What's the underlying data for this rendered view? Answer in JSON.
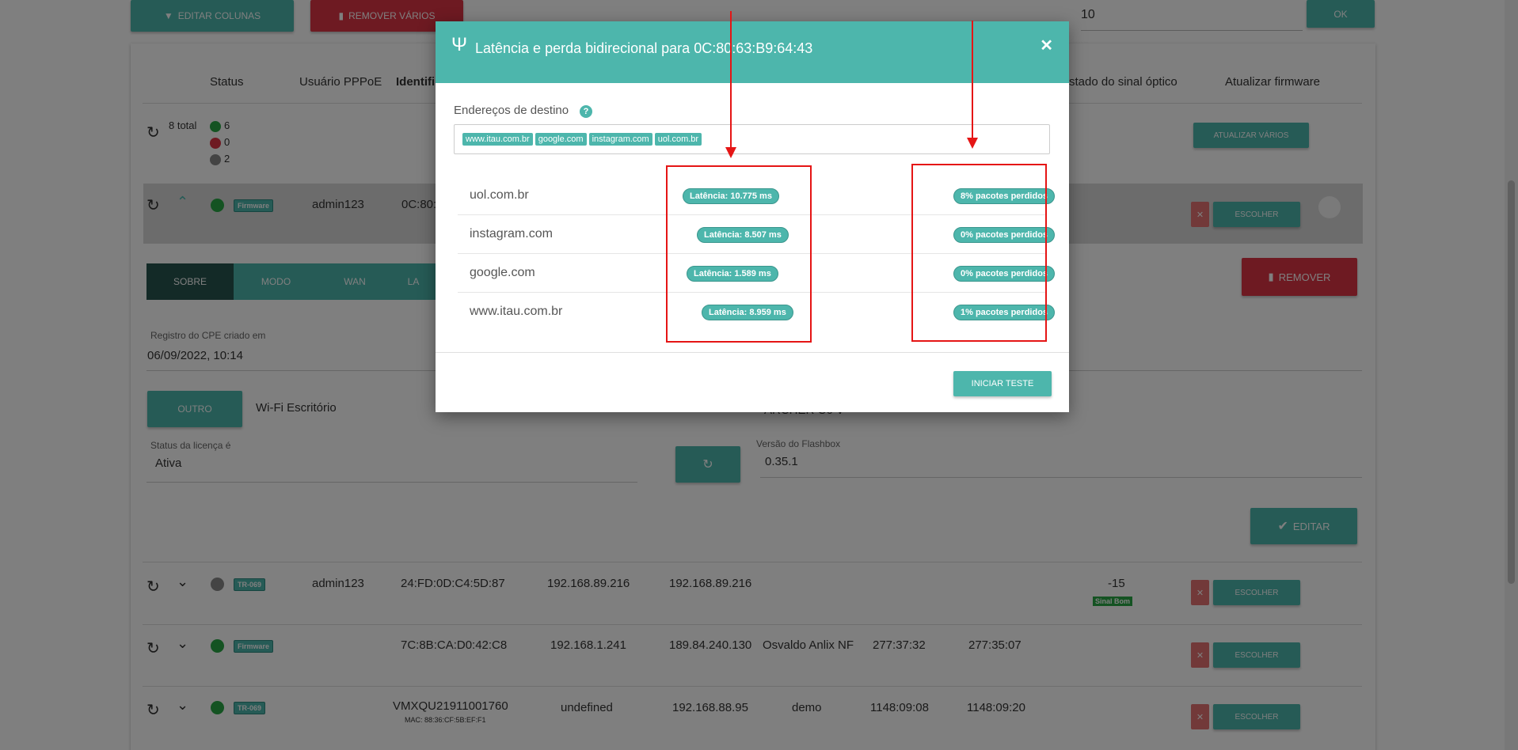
{
  "background": {
    "toolbar": {
      "edit_columns": "EDITAR COLUNAS",
      "remove_many": "REMOVER VÁRIOS",
      "per_page_value": "10",
      "ok": "OK"
    },
    "table_headers": {
      "status": "Status",
      "pppoe_user": "Usuário PPPoE",
      "identification": "Identifi",
      "optical_signal": "stado do sinal óptico",
      "update_firmware": "Atualizar firmware"
    },
    "summary": {
      "total": "8 total",
      "online": "6",
      "offline": "0",
      "unknown": "2",
      "update_many": "ATUALIZAR VÁRIOS"
    },
    "rows": [
      {
        "badge": "Firmware",
        "user": "admin123",
        "id": "0C:80:6",
        "lan_ip": "",
        "wan_ip": "",
        "name": "",
        "t1": "",
        "t2": "",
        "signal": "",
        "signal_badge": ""
      },
      {
        "badge": "TR-069",
        "user": "admin123",
        "id": "24:FD:0D:C4:5D:87",
        "lan_ip": "192.168.89.216",
        "wan_ip": "192.168.89.216",
        "name": "",
        "t1": "",
        "t2": "",
        "signal": "-15",
        "signal_badge": "Sinal Bom"
      },
      {
        "badge": "Firmware",
        "user": "",
        "id": "7C:8B:CA:D0:42:C8",
        "lan_ip": "192.168.1.241",
        "wan_ip": "189.84.240.130",
        "name": "Osvaldo Anlix NF",
        "t1": "277:37:32",
        "t2": "277:35:07",
        "signal": "",
        "signal_badge": ""
      },
      {
        "badge": "TR-069",
        "user": "",
        "id": "VMXQU21911001760",
        "mac": "MAC: 88:36:CF:5B:EF:F1",
        "lan_ip": "undefined",
        "wan_ip": "192.168.88.95",
        "name": "demo",
        "t1": "1148:09:08",
        "t2": "1148:09:20",
        "signal": "",
        "signal_badge": ""
      }
    ],
    "choose": "ESCOLHER",
    "tabs": [
      "SOBRE",
      "MODO",
      "WAN",
      "LA"
    ],
    "remove": "REMOVER",
    "edit": "EDITAR",
    "details": {
      "created_label": "Registro do CPE criado em",
      "created_value": "06/09/2022, 10:14",
      "other_button": "OUTRO",
      "wifi_name": "Wi-Fi Escritório",
      "model_partial": "ARCHER C6 V",
      "license_label": "Status da licença é",
      "license_value": "Ativa",
      "flashbox_label": "Versão do Flashbox",
      "flashbox_value": "0.35.1"
    }
  },
  "modal": {
    "title": "Latência e perda bidirecional para 0C:80:63:B9:64:43",
    "destinations_label": "Endereços de destino",
    "chips": [
      "www.itau.com.br",
      "google.com",
      "instagram.com",
      "uol.com.br"
    ],
    "results": [
      {
        "host": "uol.com.br",
        "latency": "Latência: 10.775 ms",
        "loss": "8% pacotes perdidos"
      },
      {
        "host": "instagram.com",
        "latency": "Latência: 8.507 ms",
        "loss": "0% pacotes perdidos"
      },
      {
        "host": "google.com",
        "latency": "Latência: 1.589 ms",
        "loss": "0% pacotes perdidos"
      },
      {
        "host": "www.itau.com.br",
        "latency": "Latência: 8.959 ms",
        "loss": "1% pacotes perdidos"
      }
    ],
    "start_button": "INICIAR TESTE"
  },
  "colors": {
    "accent": "#4db6ac",
    "danger": "#dc3545",
    "annotation": "#e51515"
  }
}
